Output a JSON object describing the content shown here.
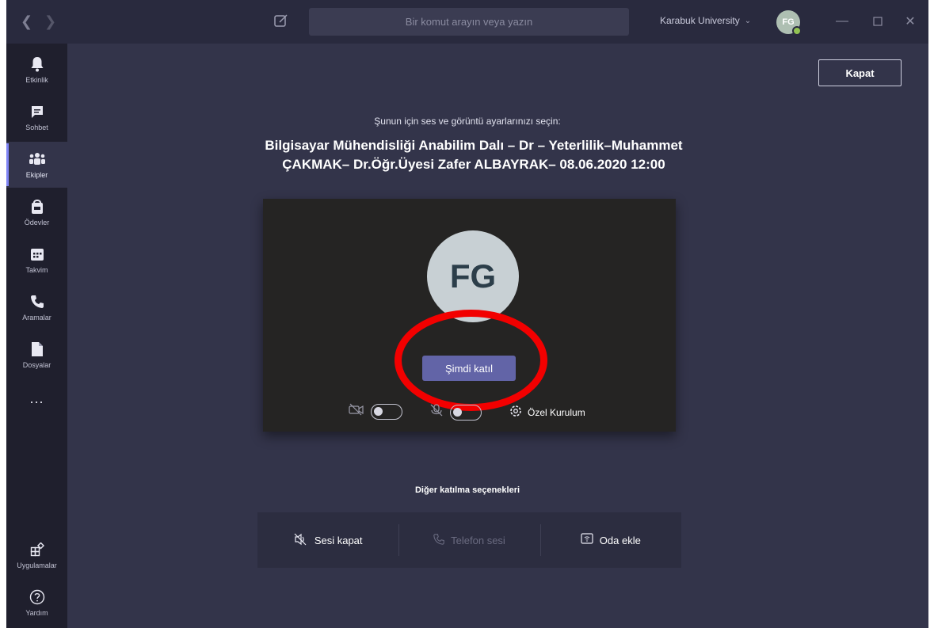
{
  "titlebar": {
    "search_placeholder": "Bir komut arayın veya yazın",
    "org_name": "Karabuk University",
    "avatar_initials": "FG"
  },
  "rail": {
    "items": [
      {
        "label": "Etkinlik",
        "icon": "bell-icon"
      },
      {
        "label": "Sohbet",
        "icon": "chat-icon"
      },
      {
        "label": "Ekipler",
        "icon": "teams-icon",
        "active": true
      },
      {
        "label": "Ödevler",
        "icon": "assignments-icon"
      },
      {
        "label": "Takvim",
        "icon": "calendar-icon"
      },
      {
        "label": "Aramalar",
        "icon": "phone-icon"
      },
      {
        "label": "Dosyalar",
        "icon": "files-icon"
      },
      {
        "label": "...",
        "icon": "more-icon"
      }
    ],
    "bottom": [
      {
        "label": "Uygulamalar",
        "icon": "apps-icon"
      },
      {
        "label": "Yardım",
        "icon": "help-icon"
      }
    ]
  },
  "main": {
    "close_label": "Kapat",
    "subtitle": "Şunun için ses ve görüntü ayarlarınızı seçin:",
    "meeting_title_line1": "Bilgisayar Mühendisliği Anabilim Dalı – Dr – Yeterlilik–Muhammet",
    "meeting_title_line2": "ÇAKMAK– Dr.Öğr.Üyesi Zafer ALBAYRAK– 08.06.2020 12:00",
    "preview": {
      "avatar_initials": "FG",
      "join_label": "Şimdi katıl",
      "camera_on": false,
      "mic_on": false,
      "device_settings_label": "Özel Kurulum"
    },
    "other_options_title": "Diğer katılma seçenekleri",
    "other_options": [
      {
        "label": "Sesi kapat",
        "enabled": true
      },
      {
        "label": "Telefon sesi",
        "enabled": false
      },
      {
        "label": "Oda ekle",
        "enabled": true
      }
    ]
  },
  "colors": {
    "accent": "#6264a7",
    "highlight_ring": "#f20000",
    "background": "#33344a",
    "rail": "#1f1f2d"
  }
}
